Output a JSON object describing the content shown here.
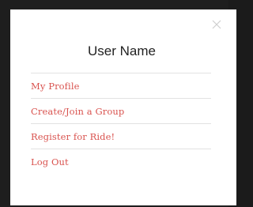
{
  "modal": {
    "title": "User Name",
    "close_icon": "close-icon",
    "colors": {
      "link": "#d9534f",
      "divider": "#e2e2e2",
      "background": "#ffffff",
      "backdrop": "#1e1e1e"
    }
  },
  "menu": {
    "items": [
      {
        "label": "My Profile"
      },
      {
        "label": "Create/Join a Group"
      },
      {
        "label": "Register for Ride!"
      },
      {
        "label": "Log Out"
      }
    ]
  }
}
